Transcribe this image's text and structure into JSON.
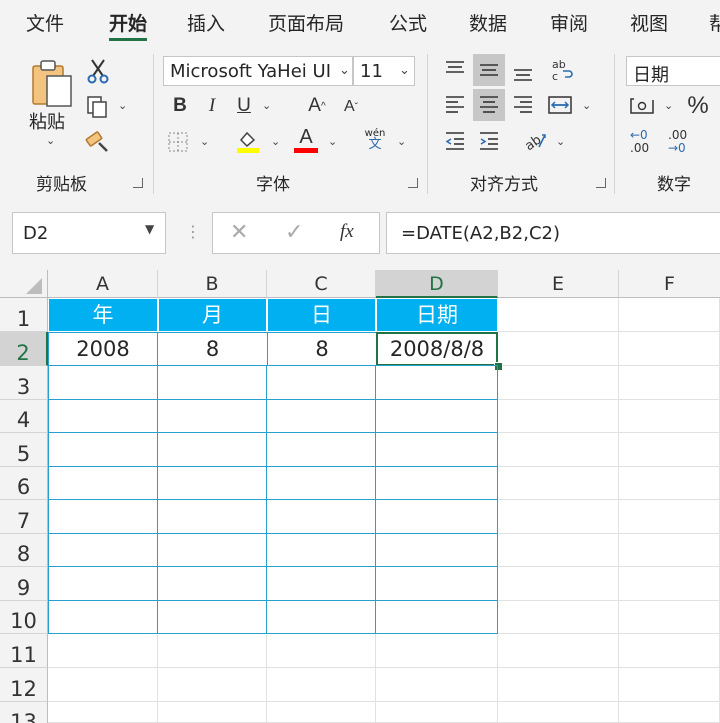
{
  "tabs": [
    "文件",
    "开始",
    "插入",
    "页面布局",
    "公式",
    "数据",
    "审阅",
    "视图",
    "帮"
  ],
  "active_tab": "开始",
  "ribbon": {
    "clipboard": {
      "paste_label": "粘贴",
      "group_label": "剪贴板"
    },
    "font": {
      "font_name": "Microsoft YaHei UI",
      "font_size": "11",
      "bold": "B",
      "italic": "I",
      "underline": "U",
      "grow": "A",
      "shrink": "A",
      "font_color_glyph": "A",
      "phonetic_top": "wén",
      "phonetic_bottom": "文",
      "group_label": "字体"
    },
    "alignment": {
      "group_label": "对齐方式"
    },
    "number": {
      "format": "日期",
      "percent": "%",
      "inc_top": "←0",
      "inc_bottom": ".00",
      "dec_top": ".00",
      "dec_bottom": "→0",
      "group_label": "数字"
    },
    "colors": {
      "accent": "#217346",
      "fill_yellow": "#ffff00",
      "font_red": "#ff0000"
    }
  },
  "formula_bar": {
    "name_box": "D2",
    "fx": "fx",
    "formula": "=DATE(A2,B2,C2)"
  },
  "sheet": {
    "columns": [
      "A",
      "B",
      "C",
      "D",
      "E",
      "F"
    ],
    "rows": [
      "1",
      "2",
      "3",
      "4",
      "5",
      "6",
      "7",
      "8",
      "9",
      "10",
      "11",
      "12",
      "13"
    ],
    "header_row": [
      "年",
      "月",
      "日",
      "日期"
    ],
    "data_row": [
      "2008",
      "8",
      "8",
      "2008/8/8"
    ],
    "selected_cell": "D2",
    "table_header_color": "#00b0f0",
    "table_border_color": "#27a0cf"
  }
}
